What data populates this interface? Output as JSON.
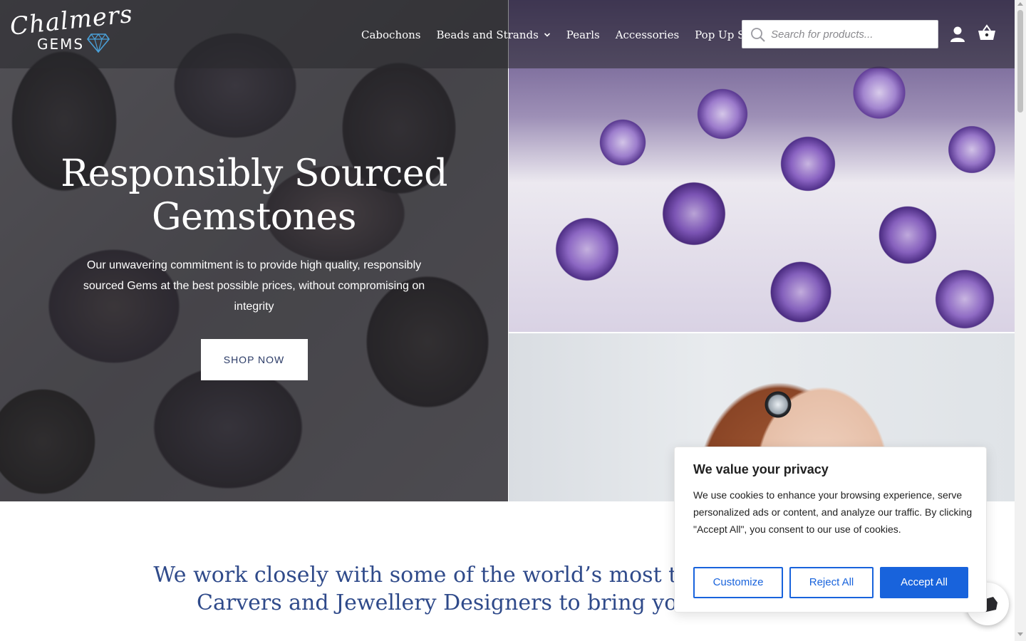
{
  "header": {
    "logo_script": "Chalmers",
    "logo_gems": "GEMS",
    "nav": [
      {
        "label": "Cabochons"
      },
      {
        "label": "Beads and Strands"
      },
      {
        "label": "Pearls"
      },
      {
        "label": "Accessories"
      },
      {
        "label": "Pop Up Shop"
      }
    ],
    "search": {
      "placeholder": "Search for products..."
    }
  },
  "hero": {
    "title": "Responsibly Sourced Gemstones",
    "subtitle": "Our unwavering commitment is to provide high quality, responsibly sourced Gems at the best possible prices, without compromising on integrity",
    "cta": "SHOP NOW"
  },
  "tagline": {
    "line1": "We work closely with some of the world’s most talente",
    "line2": "Carvers and Jewellery Designers to bring your"
  },
  "cookie": {
    "title": "We value your privacy",
    "text": "We use cookies to enhance your browsing experience, serve personalized ads or content, and analyze our traffic. By clicking \"Accept All\", you consent to our use of cookies.",
    "customize": "Customize",
    "reject": "Reject All",
    "accept": "Accept All"
  },
  "colors": {
    "brand_navy": "#2f4a8a",
    "cookie_blue": "#1863dc",
    "header_overlay": "rgba(40,40,44,0.55)"
  },
  "icons": {
    "search": "search-icon",
    "user": "user-icon",
    "cart": "cart-icon",
    "chat": "chat-icon",
    "dropdown": "chevron-down-icon",
    "logo": "diamond-icon"
  }
}
